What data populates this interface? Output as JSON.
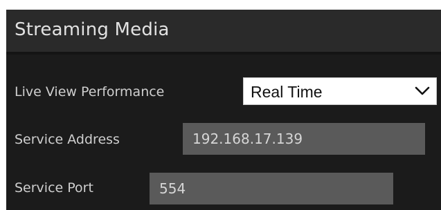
{
  "section": {
    "title": "Streaming Media"
  },
  "live_view_performance": {
    "label": "Live View Performance",
    "selected": "Real Time",
    "icon": "chevron-down-icon"
  },
  "service_address": {
    "label": "Service Address",
    "value": "192.168.17.139"
  },
  "service_port": {
    "label": "Service Port",
    "value": "554"
  },
  "colors": {
    "panel_background": "#1b1b1b",
    "header_background": "#2a2a2a",
    "field_background": "#5a5a5a",
    "label_text": "#cfcfcf",
    "select_background": "#ffffff"
  }
}
